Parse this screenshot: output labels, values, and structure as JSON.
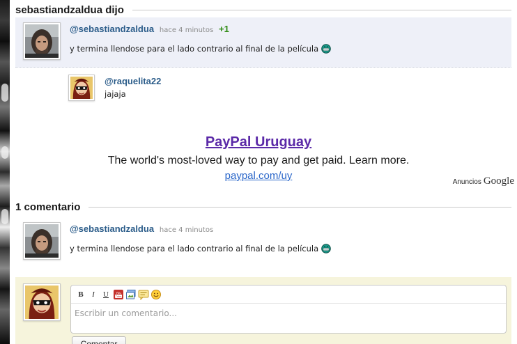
{
  "post_header": {
    "title": "sebastiandzaldua dijo"
  },
  "main_comment": {
    "username": "@sebastiandzaldua",
    "time": "hace 4 minutos",
    "vote": "+1",
    "text": "y termina llendose para el lado contrario al final de la película",
    "avatar_icon": "user-photo-man-long-hair",
    "emoticon_icon": "grin-emoticon-icon"
  },
  "reply": {
    "username": "@raquelita22",
    "text": "jajaja",
    "avatar_icon": "user-avatar-masked-cartoon"
  },
  "ad": {
    "title": "PayPal Uruguay",
    "description": "The world's most-loved way to pay and get paid. Learn more.",
    "url": "paypal.com/uy",
    "ads_label": "Anuncios",
    "ads_brand": "Google",
    "title_color": "#5b2aa8",
    "link_color": "#2a66c9"
  },
  "comments_section": {
    "title": "1 comentario",
    "comment": {
      "username": "@sebastiandzaldua",
      "time": "hace 4 minutos",
      "text": "y termina llendose para el lado contrario al final de la película",
      "emoticon_icon": "grin-emoticon-icon"
    }
  },
  "compose": {
    "placeholder": "Escribir un comentario...",
    "submit_label": "Comentar",
    "toolbar": {
      "bold": "B",
      "italic": "I",
      "underline": "U",
      "icons": [
        "youtube-icon",
        "image-icon",
        "quote-icon",
        "smiley-icon"
      ]
    },
    "background_color": "#f6f4dc"
  },
  "colors": {
    "username": "#2c5d8a",
    "vote_positive": "#2e8b13",
    "highlight_bg": "#eef0f8"
  }
}
